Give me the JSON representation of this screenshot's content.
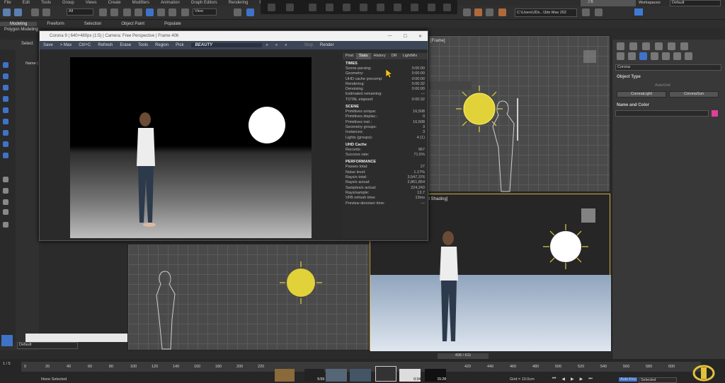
{
  "menu": [
    "File",
    "Edit",
    "Tools",
    "Group",
    "Views",
    "Create",
    "Modifiers",
    "Animation",
    "Graph Editors",
    "Rendering",
    "Custo"
  ],
  "toolbar": {
    "selection_filter": "All",
    "ref_coord": "View",
    "path_field": "C:\\Users\\JDs...\\3ds Max 202",
    "user": "J B",
    "workspace_label": "Workspaces:",
    "workspace_value": "Default"
  },
  "ribbon": {
    "tabs": [
      "Modeling",
      "Freeform",
      "Selection",
      "Object Paint",
      "Populate"
    ],
    "active": "Modeling",
    "sub": "Polygon Modeling"
  },
  "scene_explorer": {
    "select_label": "Select",
    "name_header": "Name (",
    "layer": "Default"
  },
  "vfb": {
    "title": "Corona 9 | 640×480px (1:5) | Camera: Free Perspective | Frame 406",
    "toolbar": [
      "Save",
      "> Max",
      "Ctrl+C",
      "Refresh",
      "Erase",
      "Tools",
      "Region",
      "Pick"
    ],
    "channel": "BEAUTY",
    "stop": "Stop",
    "render": "Render",
    "tabs": [
      "Post",
      "Stats",
      "History",
      "DR",
      "LightMix"
    ],
    "active_tab": "Stats",
    "sections": [
      {
        "title": "TIMES",
        "rows": [
          [
            "Scene parsing:",
            "0:00:00"
          ],
          [
            "Geometry:",
            "0:00:00"
          ],
          [
            "UHD cache precomp:",
            "0:00:00"
          ],
          [
            "Rendering:",
            "0:00:32"
          ],
          [
            "Denoising:",
            "0:00:00"
          ],
          [
            "Estimated remaining:",
            "---"
          ],
          [
            "TOTAL elapsed:",
            "0:00:32"
          ]
        ]
      },
      {
        "title": "SCENE",
        "rows": [
          [
            "Primitives unique:",
            "16,508"
          ],
          [
            "Primitives displac.:",
            "0"
          ],
          [
            "Primitives inst.:",
            "16,508"
          ],
          [
            "Geometry groups:",
            "3"
          ],
          [
            "Instances:",
            "3"
          ],
          [
            "Lights (groups):",
            "4 (1)"
          ]
        ]
      },
      {
        "title": "UHD Cache",
        "rows": [
          [
            "Records:",
            "967"
          ],
          [
            "Success rate:",
            "71.5%"
          ]
        ]
      },
      {
        "title": "PERFORMANCE",
        "rows": [
          [
            "Passes total:",
            "27"
          ],
          [
            "Noise level:",
            "1.17%"
          ],
          [
            "Rays/s total:",
            "3,547,376"
          ],
          [
            "Rays/s actual:",
            "2,861,854"
          ],
          [
            "Samples/s actual:",
            "224,243"
          ],
          [
            "Rays/sample:",
            "13.7"
          ],
          [
            "VFB refresh time:",
            "13ms"
          ],
          [
            "Preview denoiser time:",
            "---"
          ]
        ]
      }
    ]
  },
  "viewports": {
    "top_label": "[Frame]",
    "persp_label": "] [Default Shading]"
  },
  "command_panel": {
    "dropdown": "Corona",
    "object_type": "Object Type",
    "autogrid": "AutoGrid",
    "btn1": "CoronaLight",
    "btn2": "CoronaSun",
    "name_color": "Name and Color",
    "swatch": "#e0409a"
  },
  "timeline": {
    "frame_counter": "408 / 611",
    "ticks": [
      "0",
      "20",
      "40",
      "60",
      "80",
      "100",
      "120",
      "140",
      "160",
      "180",
      "200",
      "220"
    ],
    "ticks_right": [
      "420",
      "440",
      "460",
      "480",
      "500",
      "520",
      "540",
      "560",
      "580",
      "600"
    ],
    "status": "None Selected",
    "grid": "Grid = 10.0cm",
    "autokey": "Auto Key",
    "selected": "Selected",
    "frames_label": "1 / 5"
  },
  "thumbs": [
    "5:59",
    "0:34",
    "15:28"
  ]
}
